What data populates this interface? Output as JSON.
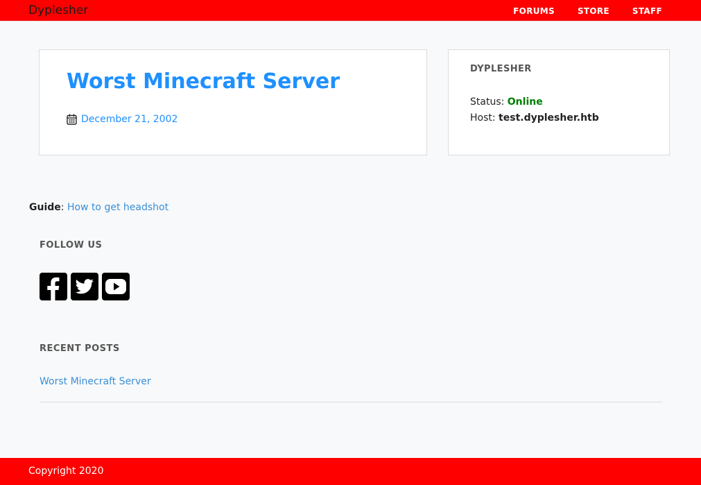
{
  "header": {
    "brand": "Dyplesher",
    "nav": [
      "FORUMS",
      "STORE",
      "STAFF"
    ],
    "bar_color": "#ff0000"
  },
  "post": {
    "title": "Worst Minecraft Server",
    "date": "December 21, 2002",
    "title_color": "#1e90ff"
  },
  "server": {
    "name": "DYPLESHER",
    "status_label": "Status:",
    "status_value": "Online",
    "status_color": "#008000",
    "host_label": "Host:",
    "host_value": "test.dyplesher.htb"
  },
  "guide": {
    "label": "Guide",
    "link_text": "How to get headshot"
  },
  "follow": {
    "title": "FOLLOW US",
    "icons": [
      "facebook-icon",
      "twitter-icon",
      "youtube-icon"
    ]
  },
  "recent_posts": {
    "title": "RECENT POSTS",
    "items": [
      "Worst Minecraft Server"
    ]
  },
  "footer": {
    "text": "Copyright 2020"
  }
}
